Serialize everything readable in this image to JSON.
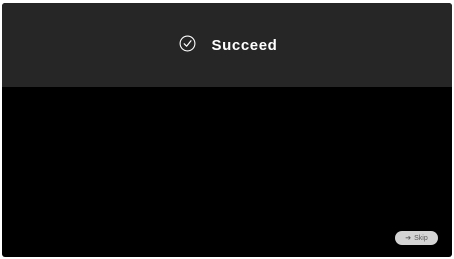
{
  "banner": {
    "icon": "check-circle-icon",
    "text": "Succeed",
    "background": "#262626"
  },
  "skip": {
    "icon": "arrow-right-icon",
    "label": "Skip"
  },
  "colors": {
    "screen": "#000000",
    "banner_text": "#ffffff",
    "skip_bg": "#d4d4d4"
  }
}
